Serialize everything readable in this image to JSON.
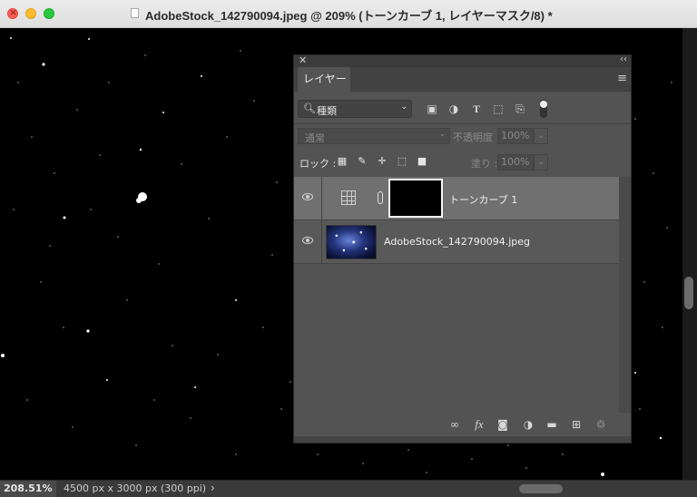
{
  "window": {
    "title": "AdobeStock_142790094.jpeg @ 209% (トーンカーブ 1, レイヤーマスク/8) *",
    "buttons": [
      "close",
      "minimize",
      "maximize"
    ]
  },
  "panel": {
    "topbar_close": "✕",
    "topbar_collapse": "‹‹",
    "tab_label": "レイヤー",
    "menu_icon": "hamburger-menu-icon",
    "filter": {
      "label": "種類",
      "icon": "search-icon"
    },
    "filter_icons": [
      "image-filter-icon",
      "adjustment-filter-icon",
      "type-filter-icon",
      "shape-filter-icon",
      "smart-object-filter-icon"
    ],
    "blend_mode": "通常",
    "opacity_label": "不透明度 :",
    "opacity_value": "100%",
    "lock_label": "ロック :",
    "lock_icons": [
      "lock-transparency-icon",
      "lock-image-icon",
      "lock-position-icon",
      "lock-artboard-icon",
      "lock-all-icon"
    ],
    "fill_label": "塗り :",
    "fill_value": "100%",
    "layers": [
      {
        "name": "トーンカーブ 1",
        "type": "adjustment",
        "visible": true,
        "selected": true
      },
      {
        "name": "AdobeStock_142790094.jpeg",
        "type": "image",
        "visible": true,
        "selected": false
      }
    ],
    "bottom_icons": [
      "link-layers-icon",
      "fx-icon",
      "add-mask-icon",
      "new-adjustment-icon",
      "new-group-icon",
      "new-layer-icon",
      "delete-layer-icon"
    ],
    "fx_label": "fx"
  },
  "status": {
    "zoom": "208.51%",
    "doc_info": "4500 px x 3000 px (300 ppi)",
    "arrow": "›"
  }
}
